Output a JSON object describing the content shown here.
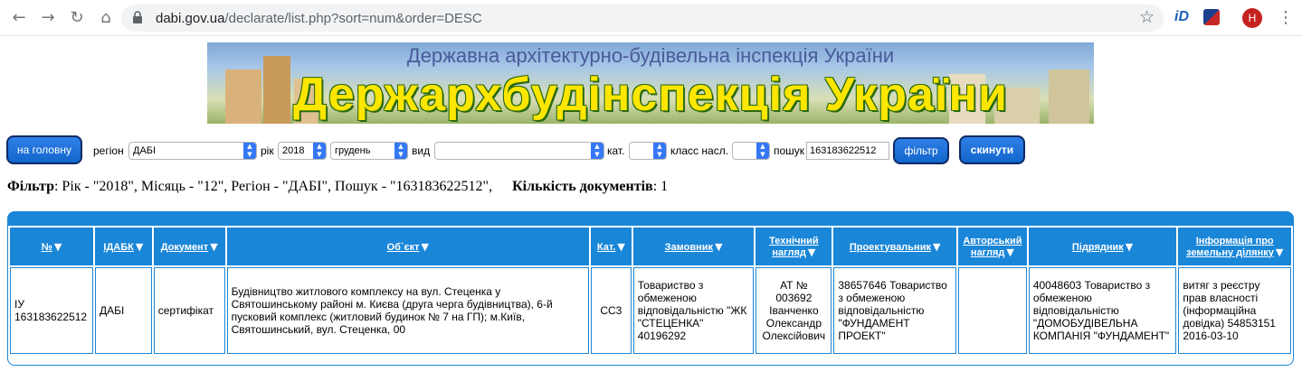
{
  "browser": {
    "url_host": "dabi.gov.ua",
    "url_path": "/declarate/list.php?sort=num&order=DESC",
    "avatar_letter": "H",
    "ext1_label": "iD"
  },
  "banner": {
    "top_text": "Державна архітектурно-будівельна інспекція України",
    "big_text": "Держархбудінспекція України"
  },
  "filters": {
    "home_button": "на головну",
    "region_label": "регіон",
    "region_value": "ДАБІ",
    "year_label": "рік",
    "year_value": "2018",
    "month_value": "грудень",
    "type_label": "вид",
    "type_value": "",
    "cat_label": "кат.",
    "cat_value": "",
    "class_label": "класс насл.",
    "class_value": "",
    "search_label": "пошук",
    "search_value": "163183622512",
    "filter_button": "фільтр",
    "reset_button": "скинути"
  },
  "summary": {
    "filter_label": "Фільтр",
    "filter_text": ": Рік - \"2018\", Місяць - \"12\", Регіон - \"ДАБІ\", Пошук - \"163183622512\",",
    "count_label": "Кількість документів",
    "count_text": ": 1"
  },
  "table": {
    "headers": [
      "№",
      "ІДАБК",
      "Документ",
      "Об`єкт",
      "Кат.",
      "Замовник",
      "Технічний нагляд",
      "Проектувальник",
      "Авторський нагляд",
      "Підрядник",
      "Інформація про земельну ділянку"
    ],
    "rows": [
      [
        "ІУ 163183622512",
        "ДАБІ",
        "сертифікат",
        "Будівництво житлового комплексу на вул. Стеценка у Святошинському районі м. Києва (друга черга будівництва), 6-й пусковий комплекс (житловий будинок № 7 на ГП); м.Київ, Святошинський, вул. Стеценка, 00",
        "СС3",
        "Товариство з обмеженою відповідальністю \"ЖК \"СТЕЦЕНКА\" 40196292",
        "АТ № 003692 Іванченко Олександр Олексійович",
        "38657646 Товариство з обмеженою відповідальністю \"ФУНДАМЕНТ ПРОЕКТ\"",
        "",
        "40048603 Товариство з обмеженою відповідальністю \"ДОМОБУДІВЕЛЬНА КОМПАНІЯ \"ФУНДАМЕНТ\"",
        "витяг з реєстру прав власності (інформаційна довідка) 54853151 2016-03-10"
      ]
    ]
  },
  "colors": {
    "table_blue": "#1a86d8",
    "button_blue": "#1266cc",
    "banner_yellow": "#ffe600"
  },
  "icons": [
    "back-arrow-icon",
    "forward-arrow-icon",
    "reload-icon",
    "home-icon",
    "lock-icon",
    "star-icon",
    "menu-dots-icon",
    "sort-down-icon",
    "chevron-updown-icon"
  ]
}
